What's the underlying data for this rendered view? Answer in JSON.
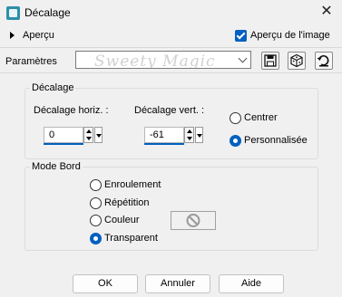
{
  "window": {
    "title": "Décalage",
    "app_icon": "app-icon",
    "close_glyph": "✕"
  },
  "preview": {
    "toggle_label": "Aperçu",
    "image_preview_label": "Aperçu de l'image",
    "image_preview_checked": true
  },
  "presets": {
    "label": "Paramètres",
    "watermark_text": "Sweety Magic",
    "value": "",
    "buttons": [
      "save-preset-icon",
      "randomize-dice-icon",
      "reset-defaults-icon"
    ]
  },
  "offset": {
    "group_title": "Décalage",
    "horizontal": {
      "label": "Décalage horiz. :",
      "value": "0"
    },
    "vertical": {
      "label": "Décalage vert. :",
      "value": "-61"
    },
    "mode_options": [
      {
        "label": "Centrer",
        "selected": false
      },
      {
        "label": "Personnalisée",
        "selected": true
      }
    ]
  },
  "edge_mode": {
    "group_title": "Mode Bord",
    "options": [
      {
        "label": "Enroulement",
        "selected": false
      },
      {
        "label": "Répétition",
        "selected": false
      },
      {
        "label": "Couleur",
        "selected": false
      },
      {
        "label": "Transparent",
        "selected": true
      }
    ],
    "color_swatch_icon": "no-color-icon"
  },
  "footer": {
    "ok": "OK",
    "cancel": "Annuler",
    "help": "Aide"
  },
  "colors": {
    "accent": "#0060c0",
    "app_icon": "#2c8fa8",
    "background": "#f0f0f0"
  }
}
